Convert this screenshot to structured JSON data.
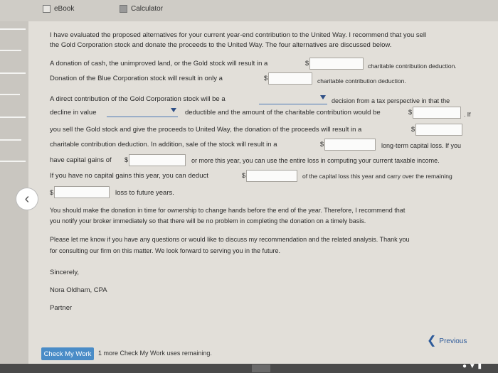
{
  "tabs": {
    "ebook": "eBook",
    "calculator": "Calculator"
  },
  "paragraph1": {
    "line1": "I have evaluated the proposed alternatives for your current year-end contribution to the United Way. I recommend that you sell",
    "line2": "the Gold Corporation stock and donate the proceeds to the United Way. The four alternatives are discussed below."
  },
  "row_donation": {
    "before": "A donation of cash, the unimproved land, or the Gold stock will result in a",
    "dollar": "$",
    "after": "charitable contribution deduction."
  },
  "row_blue": {
    "before": "Donation of the Blue Corporation stock will result in only a",
    "dollar": "$",
    "after": "charitable contribution deduction."
  },
  "row_direct": {
    "before": "A direct contribution of the Gold Corporation stock will be a",
    "after": "decision from a tax perspective in that the"
  },
  "row_decline": {
    "before": "decline in value",
    "middle": "deductible and the amount of the charitable contribution would be",
    "dollar": "$",
    "after": ". If"
  },
  "row_sell": {
    "before": "you sell the Gold stock and give the proceeds to United Way, the donation of the proceeds will result in a",
    "dollar": "$"
  },
  "row_charitable": {
    "before": "charitable contribution deduction. In addition, sale of the stock will result in a",
    "dollar": "$",
    "after": "long-term capital loss. If you"
  },
  "row_gains": {
    "before": "have capital gains of",
    "dollar": "$",
    "after": "or more this year, you can use the entire loss in computing your current taxable income."
  },
  "row_nogains": {
    "before": "If you have no capital gains this year, you can deduct",
    "dollar": "$",
    "after": "of the capital loss this year and carry over the remaining"
  },
  "row_future": {
    "dollar": "$",
    "after": "loss to future years."
  },
  "paragraph_broker": {
    "line1": "You should make the donation in time for ownership to change hands before the end of the year. Therefore, I recommend that",
    "line2": "you notify your broker immediately so that there will be no problem in completing the donation on a timely basis."
  },
  "paragraph_questions": {
    "line1": "Please let me know if you have any questions or would like to discuss my recommendation and the related analysis. Thank you",
    "line2": "for consulting our firm on this matter. We look forward to serving you in the future."
  },
  "closing": {
    "sincerely": "Sincerely,",
    "name": "Nora Oldham, CPA",
    "title": "Partner"
  },
  "footer": {
    "check_label": "Check My Work",
    "remaining": "1 more Check My Work uses remaining.",
    "previous_label": "Previous"
  },
  "icons": {
    "back": "chevron-left-icon",
    "previous": "chevron-left-icon"
  },
  "colors": {
    "accent": "#4a8cc7",
    "link": "#2d5a9a"
  }
}
